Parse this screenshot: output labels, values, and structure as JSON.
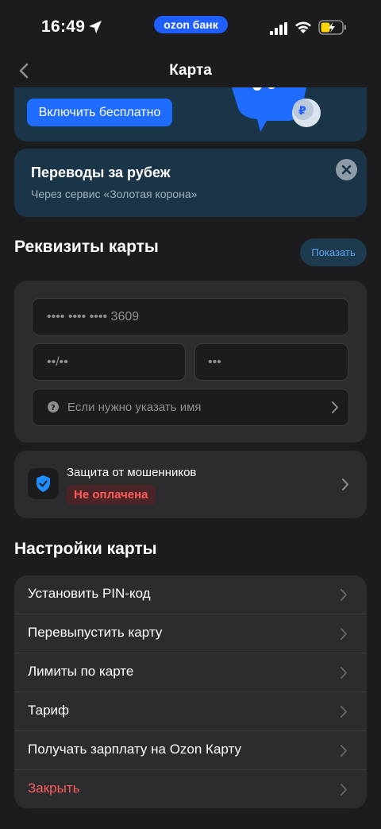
{
  "status_bar": {
    "time": "16:49",
    "bank_label": "ozon банк"
  },
  "header": {
    "title": "Карта"
  },
  "promo": {
    "button_label": "Включить бесплатно"
  },
  "transfers": {
    "title": "Переводы за рубеж",
    "subtitle": "Через сервис «Золотая корона»"
  },
  "requisites": {
    "title": "Реквизиты карты",
    "show_label": "Показать",
    "card_number": "•••• •••• •••• 3609",
    "expiry": "••/••",
    "cvv": "•••",
    "name_placeholder": "Если нужно указать имя"
  },
  "fraud": {
    "title": "Защита от мошенников",
    "status": "Не оплачена"
  },
  "settings": {
    "title": "Настройки карты",
    "items": [
      {
        "label": "Установить PIN-код"
      },
      {
        "label": "Перевыпустить карту"
      },
      {
        "label": "Лимиты по карте"
      },
      {
        "label": "Тариф"
      },
      {
        "label": "Получать зарплату на Ozon Карту"
      },
      {
        "label": "Закрыть"
      }
    ]
  },
  "colors": {
    "accent": "#1f6cff",
    "danger": "#ff5b5b",
    "background": "#1c1c1e",
    "card": "#2c2c2e"
  }
}
